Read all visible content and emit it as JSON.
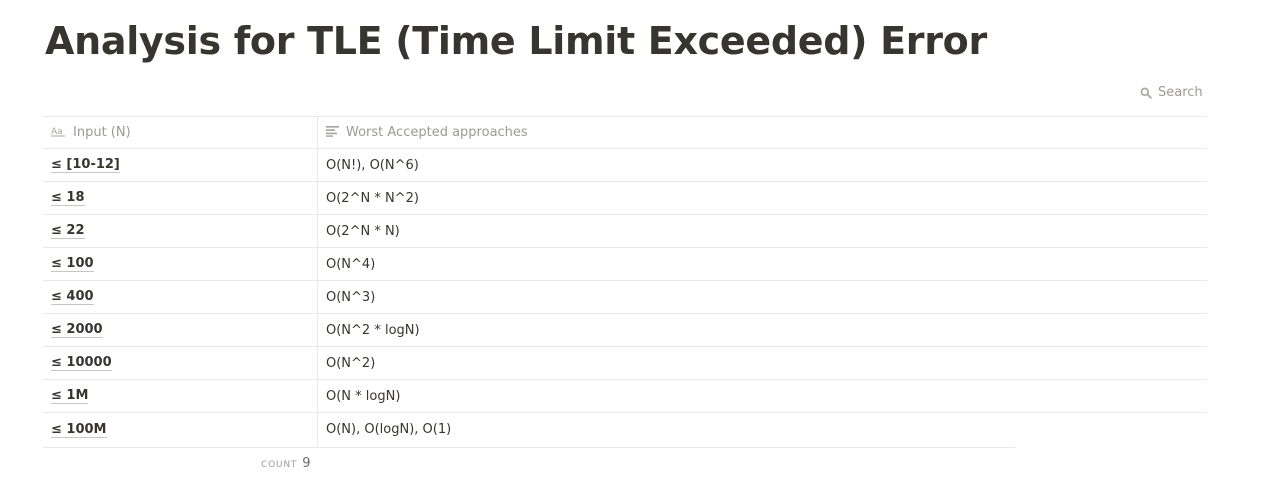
{
  "page": {
    "title": "Analysis for TLE (Time Limit Exceeded) Error"
  },
  "search": {
    "label": "Search"
  },
  "table": {
    "columns": [
      {
        "label": "Input (N)",
        "icon": "title-property-icon"
      },
      {
        "label": "Worst Accepted approaches",
        "icon": "text-property-icon"
      }
    ],
    "rows": [
      {
        "input": "≤ [10-12]",
        "approach": "O(N!), O(N^6)"
      },
      {
        "input": "≤ 18",
        "approach": "O(2^N * N^2)"
      },
      {
        "input": "≤ 22",
        "approach": "O(2^N * N)"
      },
      {
        "input": "≤ 100",
        "approach": "O(N^4)"
      },
      {
        "input": "≤ 400",
        "approach": "O(N^3)"
      },
      {
        "input": "≤ 2000",
        "approach": "O(N^2 * logN)"
      },
      {
        "input": "≤ 10000",
        "approach": "O(N^2)"
      },
      {
        "input": "≤ 1M",
        "approach": "O(N * logN)"
      },
      {
        "input": "≤ 100M",
        "approach": "O(N), O(logN), O(1)"
      }
    ]
  },
  "footer": {
    "count_label": "COUNT",
    "count_value": "9"
  }
}
